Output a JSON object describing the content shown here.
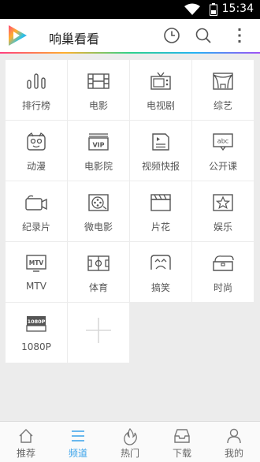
{
  "status": {
    "time": "15:34"
  },
  "header": {
    "title": "响巢看看"
  },
  "channels": [
    {
      "label": "排行榜",
      "icon": "bar-chart-icon"
    },
    {
      "label": "电影",
      "icon": "film-icon"
    },
    {
      "label": "电视剧",
      "icon": "tv-icon"
    },
    {
      "label": "综艺",
      "icon": "stage-icon"
    },
    {
      "label": "动漫",
      "icon": "cartoon-face-icon"
    },
    {
      "label": "电影院",
      "icon": "vip-ticket-icon"
    },
    {
      "label": "视频快报",
      "icon": "video-news-icon"
    },
    {
      "label": "公开课",
      "icon": "abc-board-icon"
    },
    {
      "label": "纪录片",
      "icon": "camera-icon"
    },
    {
      "label": "微电影",
      "icon": "film-reel-icon"
    },
    {
      "label": "片花",
      "icon": "clapperboard-icon"
    },
    {
      "label": "娱乐",
      "icon": "star-icon"
    },
    {
      "label": "MTV",
      "icon": "mtv-icon"
    },
    {
      "label": "体育",
      "icon": "field-icon"
    },
    {
      "label": "搞笑",
      "icon": "laugh-icon"
    },
    {
      "label": "时尚",
      "icon": "handbag-icon"
    },
    {
      "label": "1080P",
      "icon": "hd-1080p-icon",
      "badge": "1080P"
    }
  ],
  "tabs": [
    {
      "label": "推荐",
      "icon": "home-icon",
      "active": false
    },
    {
      "label": "频道",
      "icon": "menu-icon",
      "active": true
    },
    {
      "label": "热门",
      "icon": "flame-icon",
      "active": false
    },
    {
      "label": "下载",
      "icon": "inbox-icon",
      "active": false
    },
    {
      "label": "我的",
      "icon": "user-icon",
      "active": false
    }
  ],
  "colors": {
    "accent": "#39a2ea",
    "icon": "#555555",
    "grid_bg": "#ececec"
  }
}
